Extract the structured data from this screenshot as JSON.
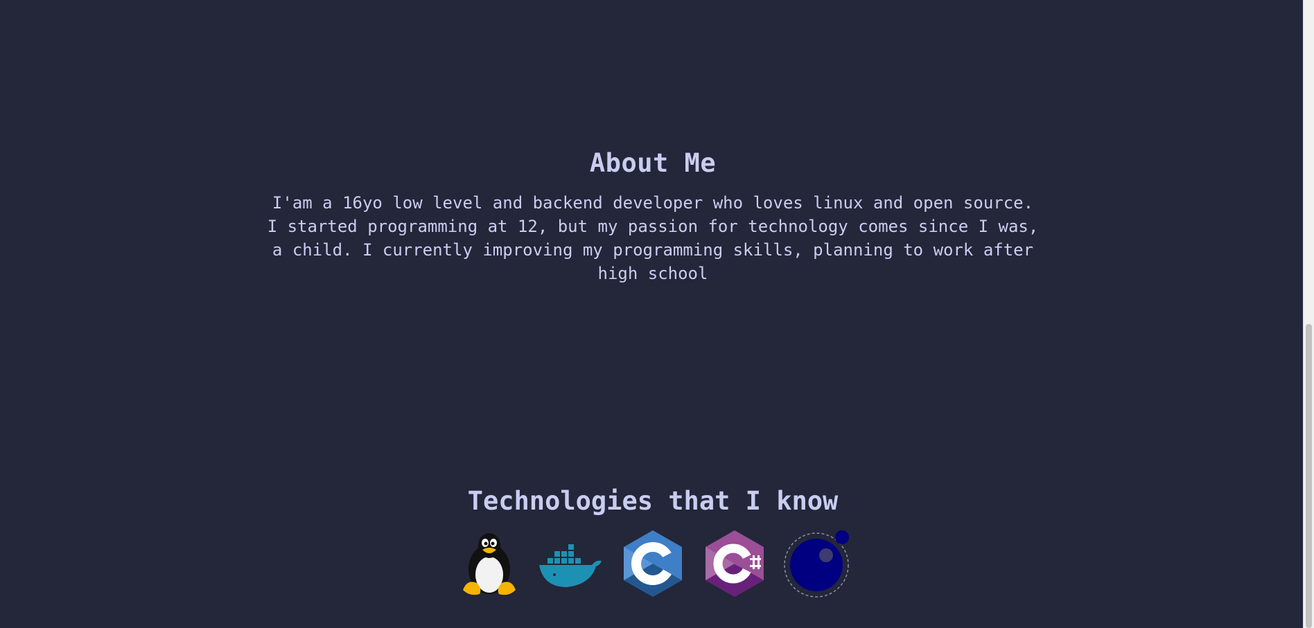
{
  "about": {
    "title": "About Me",
    "lines": [
      "I'am a 16yo low level and backend developer who loves linux and open source.",
      "I started programming at 12, but my passion for technology comes since I was,",
      "a child. I currently improving my programming skills, planning to work after",
      "high school"
    ]
  },
  "technologies": {
    "title": "Technologies that I know",
    "icons": [
      "linux-tux-icon",
      "docker-icon",
      "c-language-icon",
      "csharp-icon",
      "moon-orbit-icon"
    ]
  },
  "colors": {
    "background": "#242639",
    "text": "#c9cdf0"
  }
}
